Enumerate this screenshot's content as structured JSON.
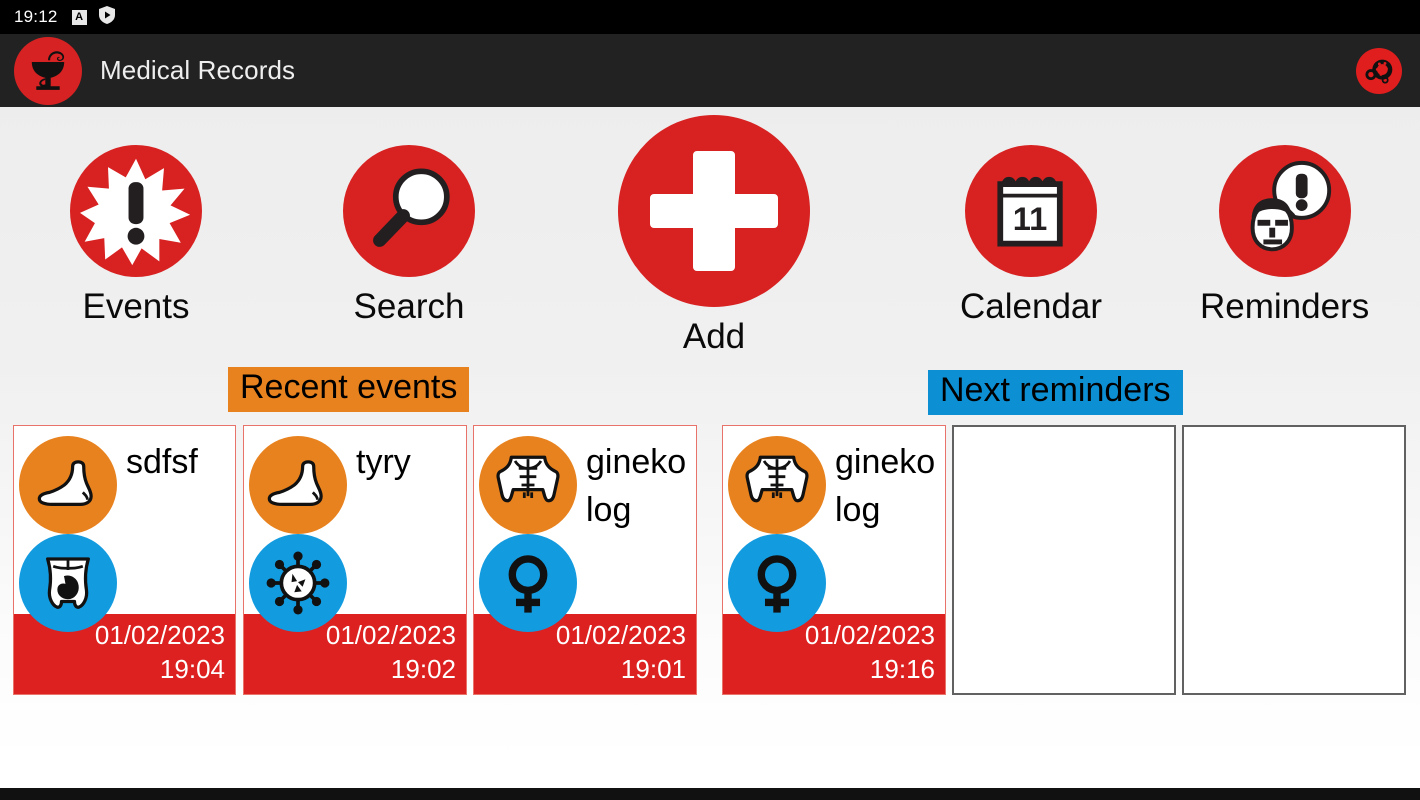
{
  "statusbar": {
    "clock": "19:12",
    "icons": [
      {
        "name": "letter-a-badge-icon",
        "glyph": "A"
      },
      {
        "name": "shield-play-icon",
        "glyph": "shield"
      }
    ]
  },
  "appbar": {
    "logo_icon": "bowl-of-hygieia-icon",
    "title": "Medical Records",
    "settings_icon": "gears-settings-icon"
  },
  "nav": {
    "items": [
      {
        "key": "events",
        "label": "Events",
        "icon": "starburst-exclamation-icon"
      },
      {
        "key": "search",
        "label": "Search",
        "icon": "magnifier-icon"
      },
      {
        "key": "add",
        "label": "Add",
        "icon": "plus-cross-icon"
      },
      {
        "key": "calendar",
        "label": "Calendar",
        "icon": "calendar-icon",
        "day": "11"
      },
      {
        "key": "reminders",
        "label": "Reminders",
        "icon": "head-speech-bubble-exclamation-icon"
      }
    ]
  },
  "sections": {
    "recent_events": {
      "title": "Recent events",
      "accent": "#E8821E"
    },
    "next_reminders": {
      "title": "Next reminders",
      "accent": "#0D8FD4"
    }
  },
  "recent_events": [
    {
      "title": "sdfsf",
      "date": "01/02/2023",
      "time": "19:04",
      "icon_top": "foot-icon",
      "icon_bottom": "abdomen-stomach-icon",
      "icon_top_color": "#E8821E",
      "icon_bottom_color": "#139BE0"
    },
    {
      "title": "tyry",
      "date": "01/02/2023",
      "time": "19:02",
      "icon_top": "foot-icon",
      "icon_bottom": "virus-icon",
      "icon_top_color": "#E8821E",
      "icon_bottom_color": "#139BE0"
    },
    {
      "title": "ginekolog",
      "date": "01/02/2023",
      "time": "19:01",
      "icon_top": "torso-icon",
      "icon_bottom": "female-venus-icon",
      "icon_top_color": "#E8821E",
      "icon_bottom_color": "#139BE0"
    }
  ],
  "next_reminders": [
    {
      "title": "ginekolog",
      "date": "01/02/2023",
      "time": "19:16",
      "icon_top": "torso-icon",
      "icon_bottom": "female-venus-icon",
      "icon_top_color": "#E8821E",
      "icon_bottom_color": "#139BE0",
      "empty": false
    },
    {
      "title": "",
      "date": "",
      "time": "",
      "empty": true
    },
    {
      "title": "",
      "date": "",
      "time": "",
      "empty": true
    }
  ],
  "colors": {
    "brand_red": "#D82222",
    "footer_red": "#DD2020",
    "orange": "#E8821E",
    "blue": "#0D8FD4",
    "icon_blue": "#139BE0",
    "appbar": "#222222",
    "statusbar": "#000000",
    "page_bg": "#EDEDED"
  }
}
